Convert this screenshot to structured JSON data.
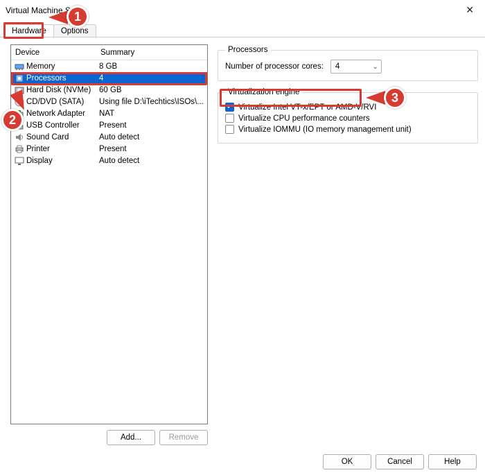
{
  "window": {
    "title": "Virtual Machine Set"
  },
  "tabs": {
    "hardware": "Hardware",
    "options": "Options"
  },
  "table": {
    "headers": {
      "device": "Device",
      "summary": "Summary"
    },
    "rows": [
      {
        "icon": "memory-icon",
        "label": "Memory",
        "summary": "8 GB"
      },
      {
        "icon": "cpu-icon",
        "label": "Processors",
        "summary": "4",
        "selected": true
      },
      {
        "icon": "hdd-icon",
        "label": "Hard Disk (NVMe)",
        "summary": "60 GB"
      },
      {
        "icon": "disc-icon",
        "label": "CD/DVD (SATA)",
        "summary": "Using file D:\\iTechtics\\ISOs\\..."
      },
      {
        "icon": "net-icon",
        "label": "Network Adapter",
        "summary": "NAT"
      },
      {
        "icon": "usb-icon",
        "label": "USB Controller",
        "summary": "Present"
      },
      {
        "icon": "sound-icon",
        "label": "Sound Card",
        "summary": "Auto detect"
      },
      {
        "icon": "printer-icon",
        "label": "Printer",
        "summary": "Present"
      },
      {
        "icon": "display-icon",
        "label": "Display",
        "summary": "Auto detect"
      }
    ]
  },
  "buttons": {
    "add": "Add...",
    "remove": "Remove",
    "ok": "OK",
    "cancel": "Cancel",
    "help": "Help"
  },
  "processors": {
    "legend": "Processors",
    "cores_label": "Number of processor cores:",
    "cores_value": "4"
  },
  "virt": {
    "legend": "Virtualization engine",
    "vt": "Virtualize Intel VT-x/EPT or AMD-V/RVI",
    "perf": "Virtualize CPU performance counters",
    "iommu": "Virtualize IOMMU (IO memory management unit)"
  },
  "annotations": {
    "n1": "1",
    "n2": "2",
    "n3": "3"
  }
}
